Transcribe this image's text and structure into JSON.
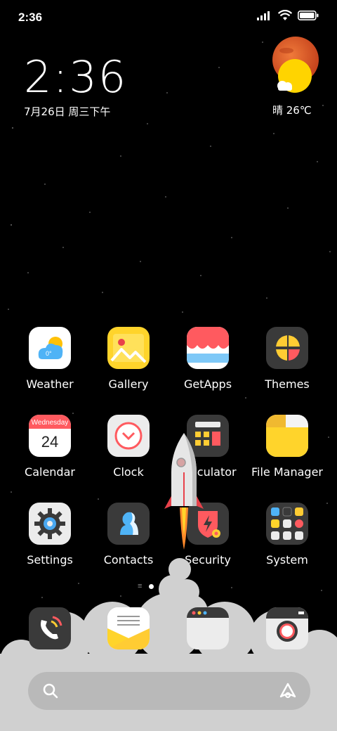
{
  "status_bar": {
    "time": "2:36",
    "icons": [
      "signal-icon",
      "wifi-icon",
      "battery-icon"
    ]
  },
  "clock_widget": {
    "time": "2:36",
    "date": "7月26日 周三下午"
  },
  "weather_widget": {
    "condition": "晴",
    "temperature": "26℃",
    "text": "晴 26℃"
  },
  "apps": [
    {
      "label": "Weather",
      "icon": "weather-icon",
      "temp": "0°"
    },
    {
      "label": "Gallery",
      "icon": "gallery-icon"
    },
    {
      "label": "GetApps",
      "icon": "getapps-icon"
    },
    {
      "label": "Themes",
      "icon": "themes-icon"
    },
    {
      "label": "Calendar",
      "icon": "calendar-icon",
      "weekday": "Wednesday",
      "day": "24"
    },
    {
      "label": "Clock",
      "icon": "clock-icon"
    },
    {
      "label": "Calculator",
      "icon": "calculator-icon"
    },
    {
      "label": "File Manager",
      "icon": "file-manager-icon"
    },
    {
      "label": "Settings",
      "icon": "gear-icon"
    },
    {
      "label": "Contacts",
      "icon": "contacts-icon"
    },
    {
      "label": "Security",
      "icon": "security-icon"
    },
    {
      "label": "System",
      "icon": "folder-icon"
    }
  ],
  "dock": [
    "phone-icon",
    "messages-icon",
    "browser-icon",
    "camera-icon"
  ],
  "page_indicator": {
    "pages": 2,
    "active": 1
  },
  "colors": {
    "background": "#000000",
    "search_bar": "#b9b9b9",
    "cloud": "#d0d0d0"
  }
}
